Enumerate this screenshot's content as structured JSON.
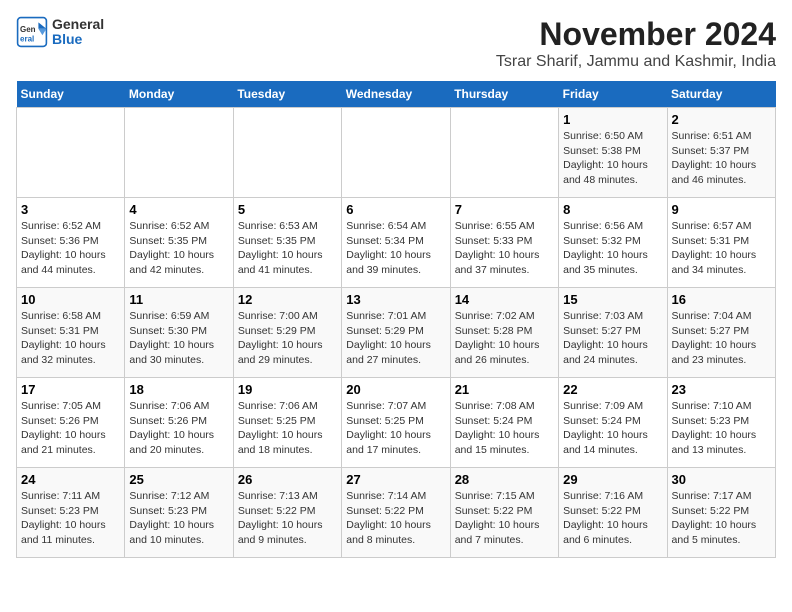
{
  "header": {
    "logo_general": "General",
    "logo_blue": "Blue",
    "title": "November 2024",
    "subtitle": "Tsrar Sharif, Jammu and Kashmir, India"
  },
  "weekdays": [
    "Sunday",
    "Monday",
    "Tuesday",
    "Wednesday",
    "Thursday",
    "Friday",
    "Saturday"
  ],
  "weeks": [
    [
      {
        "day": "",
        "info": ""
      },
      {
        "day": "",
        "info": ""
      },
      {
        "day": "",
        "info": ""
      },
      {
        "day": "",
        "info": ""
      },
      {
        "day": "",
        "info": ""
      },
      {
        "day": "1",
        "info": "Sunrise: 6:50 AM\nSunset: 5:38 PM\nDaylight: 10 hours\nand 48 minutes."
      },
      {
        "day": "2",
        "info": "Sunrise: 6:51 AM\nSunset: 5:37 PM\nDaylight: 10 hours\nand 46 minutes."
      }
    ],
    [
      {
        "day": "3",
        "info": "Sunrise: 6:52 AM\nSunset: 5:36 PM\nDaylight: 10 hours\nand 44 minutes."
      },
      {
        "day": "4",
        "info": "Sunrise: 6:52 AM\nSunset: 5:35 PM\nDaylight: 10 hours\nand 42 minutes."
      },
      {
        "day": "5",
        "info": "Sunrise: 6:53 AM\nSunset: 5:35 PM\nDaylight: 10 hours\nand 41 minutes."
      },
      {
        "day": "6",
        "info": "Sunrise: 6:54 AM\nSunset: 5:34 PM\nDaylight: 10 hours\nand 39 minutes."
      },
      {
        "day": "7",
        "info": "Sunrise: 6:55 AM\nSunset: 5:33 PM\nDaylight: 10 hours\nand 37 minutes."
      },
      {
        "day": "8",
        "info": "Sunrise: 6:56 AM\nSunset: 5:32 PM\nDaylight: 10 hours\nand 35 minutes."
      },
      {
        "day": "9",
        "info": "Sunrise: 6:57 AM\nSunset: 5:31 PM\nDaylight: 10 hours\nand 34 minutes."
      }
    ],
    [
      {
        "day": "10",
        "info": "Sunrise: 6:58 AM\nSunset: 5:31 PM\nDaylight: 10 hours\nand 32 minutes."
      },
      {
        "day": "11",
        "info": "Sunrise: 6:59 AM\nSunset: 5:30 PM\nDaylight: 10 hours\nand 30 minutes."
      },
      {
        "day": "12",
        "info": "Sunrise: 7:00 AM\nSunset: 5:29 PM\nDaylight: 10 hours\nand 29 minutes."
      },
      {
        "day": "13",
        "info": "Sunrise: 7:01 AM\nSunset: 5:29 PM\nDaylight: 10 hours\nand 27 minutes."
      },
      {
        "day": "14",
        "info": "Sunrise: 7:02 AM\nSunset: 5:28 PM\nDaylight: 10 hours\nand 26 minutes."
      },
      {
        "day": "15",
        "info": "Sunrise: 7:03 AM\nSunset: 5:27 PM\nDaylight: 10 hours\nand 24 minutes."
      },
      {
        "day": "16",
        "info": "Sunrise: 7:04 AM\nSunset: 5:27 PM\nDaylight: 10 hours\nand 23 minutes."
      }
    ],
    [
      {
        "day": "17",
        "info": "Sunrise: 7:05 AM\nSunset: 5:26 PM\nDaylight: 10 hours\nand 21 minutes."
      },
      {
        "day": "18",
        "info": "Sunrise: 7:06 AM\nSunset: 5:26 PM\nDaylight: 10 hours\nand 20 minutes."
      },
      {
        "day": "19",
        "info": "Sunrise: 7:06 AM\nSunset: 5:25 PM\nDaylight: 10 hours\nand 18 minutes."
      },
      {
        "day": "20",
        "info": "Sunrise: 7:07 AM\nSunset: 5:25 PM\nDaylight: 10 hours\nand 17 minutes."
      },
      {
        "day": "21",
        "info": "Sunrise: 7:08 AM\nSunset: 5:24 PM\nDaylight: 10 hours\nand 15 minutes."
      },
      {
        "day": "22",
        "info": "Sunrise: 7:09 AM\nSunset: 5:24 PM\nDaylight: 10 hours\nand 14 minutes."
      },
      {
        "day": "23",
        "info": "Sunrise: 7:10 AM\nSunset: 5:23 PM\nDaylight: 10 hours\nand 13 minutes."
      }
    ],
    [
      {
        "day": "24",
        "info": "Sunrise: 7:11 AM\nSunset: 5:23 PM\nDaylight: 10 hours\nand 11 minutes."
      },
      {
        "day": "25",
        "info": "Sunrise: 7:12 AM\nSunset: 5:23 PM\nDaylight: 10 hours\nand 10 minutes."
      },
      {
        "day": "26",
        "info": "Sunrise: 7:13 AM\nSunset: 5:22 PM\nDaylight: 10 hours\nand 9 minutes."
      },
      {
        "day": "27",
        "info": "Sunrise: 7:14 AM\nSunset: 5:22 PM\nDaylight: 10 hours\nand 8 minutes."
      },
      {
        "day": "28",
        "info": "Sunrise: 7:15 AM\nSunset: 5:22 PM\nDaylight: 10 hours\nand 7 minutes."
      },
      {
        "day": "29",
        "info": "Sunrise: 7:16 AM\nSunset: 5:22 PM\nDaylight: 10 hours\nand 6 minutes."
      },
      {
        "day": "30",
        "info": "Sunrise: 7:17 AM\nSunset: 5:22 PM\nDaylight: 10 hours\nand 5 minutes."
      }
    ]
  ]
}
